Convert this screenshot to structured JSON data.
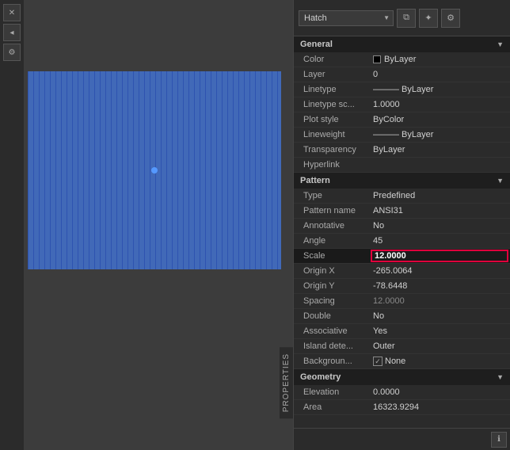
{
  "title": "Hatch",
  "toolbar": {
    "dropdown_value": "Hatch",
    "icons": [
      "copy-icon",
      "plus-icon",
      "settings-icon"
    ]
  },
  "sections": {
    "general": {
      "label": "General",
      "properties": [
        {
          "name": "Color",
          "value": "ByLayer",
          "has_swatch": true
        },
        {
          "name": "Layer",
          "value": "0"
        },
        {
          "name": "Linetype",
          "value": "ByLayer"
        },
        {
          "name": "Linetype sc...",
          "value": "1.0000"
        },
        {
          "name": "Plot style",
          "value": "ByColor"
        },
        {
          "name": "Lineweight",
          "value": "ByLayer"
        },
        {
          "name": "Transparency",
          "value": "ByLayer"
        },
        {
          "name": "Hyperlink",
          "value": ""
        }
      ]
    },
    "pattern": {
      "label": "Pattern",
      "properties": [
        {
          "name": "Type",
          "value": "Predefined"
        },
        {
          "name": "Pattern name",
          "value": "ANSI31"
        },
        {
          "name": "Annotative",
          "value": "No"
        },
        {
          "name": "Angle",
          "value": "45"
        },
        {
          "name": "Scale",
          "value": "12.0000",
          "highlighted": true
        },
        {
          "name": "Origin X",
          "value": "-265.0064"
        },
        {
          "name": "Origin Y",
          "value": "-78.6448"
        },
        {
          "name": "Spacing",
          "value": "12.0000"
        },
        {
          "name": "Double",
          "value": "No"
        },
        {
          "name": "Associative",
          "value": "Yes"
        },
        {
          "name": "Island dete...",
          "value": "Outer"
        },
        {
          "name": "Backgroun...",
          "value": "None",
          "has_checkbox": true
        }
      ]
    },
    "geometry": {
      "label": "Geometry",
      "properties": [
        {
          "name": "Elevation",
          "value": "0.0000"
        },
        {
          "name": "Area",
          "value": "16323.9294"
        }
      ]
    }
  },
  "properties_label": "PROPERTIES",
  "drawing": {
    "dot_label": "hatch-center-dot"
  }
}
